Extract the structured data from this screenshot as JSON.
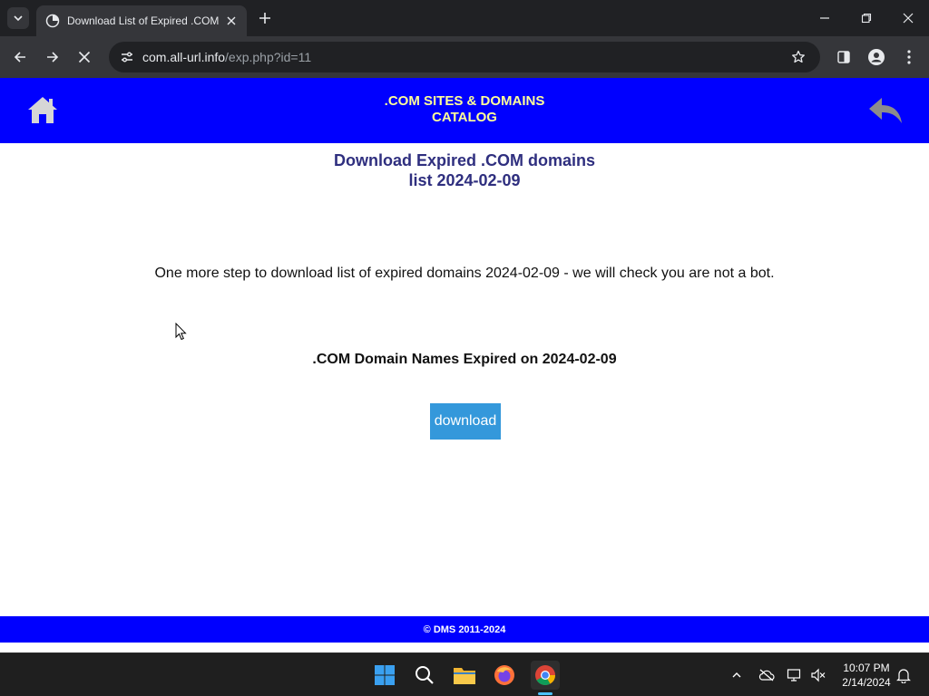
{
  "browser": {
    "tab_title": "Download List of Expired .COM",
    "url_host": "com.all-url.info",
    "url_path": "/exp.php?id=11"
  },
  "page": {
    "header_title_line1": ".COM SITES & DOMAINS",
    "header_title_line2": "CATALOG",
    "title_line1": "Download Expired .COM domains",
    "title_line2": "list 2024-02-09",
    "message": "One more step to download list of expired domains 2024-02-09 - we will check you are not a bot.",
    "subhead": ".COM Domain Names Expired on 2024-02-09",
    "download_label": "download",
    "footer": "© DMS 2011-2024"
  },
  "taskbar": {
    "time": "10:07 PM",
    "date": "2/14/2024"
  },
  "colors": {
    "header_bg": "#0000ff",
    "header_text": "#ffff99",
    "title_text": "#2f2f7f",
    "button_bg": "#3498db"
  }
}
